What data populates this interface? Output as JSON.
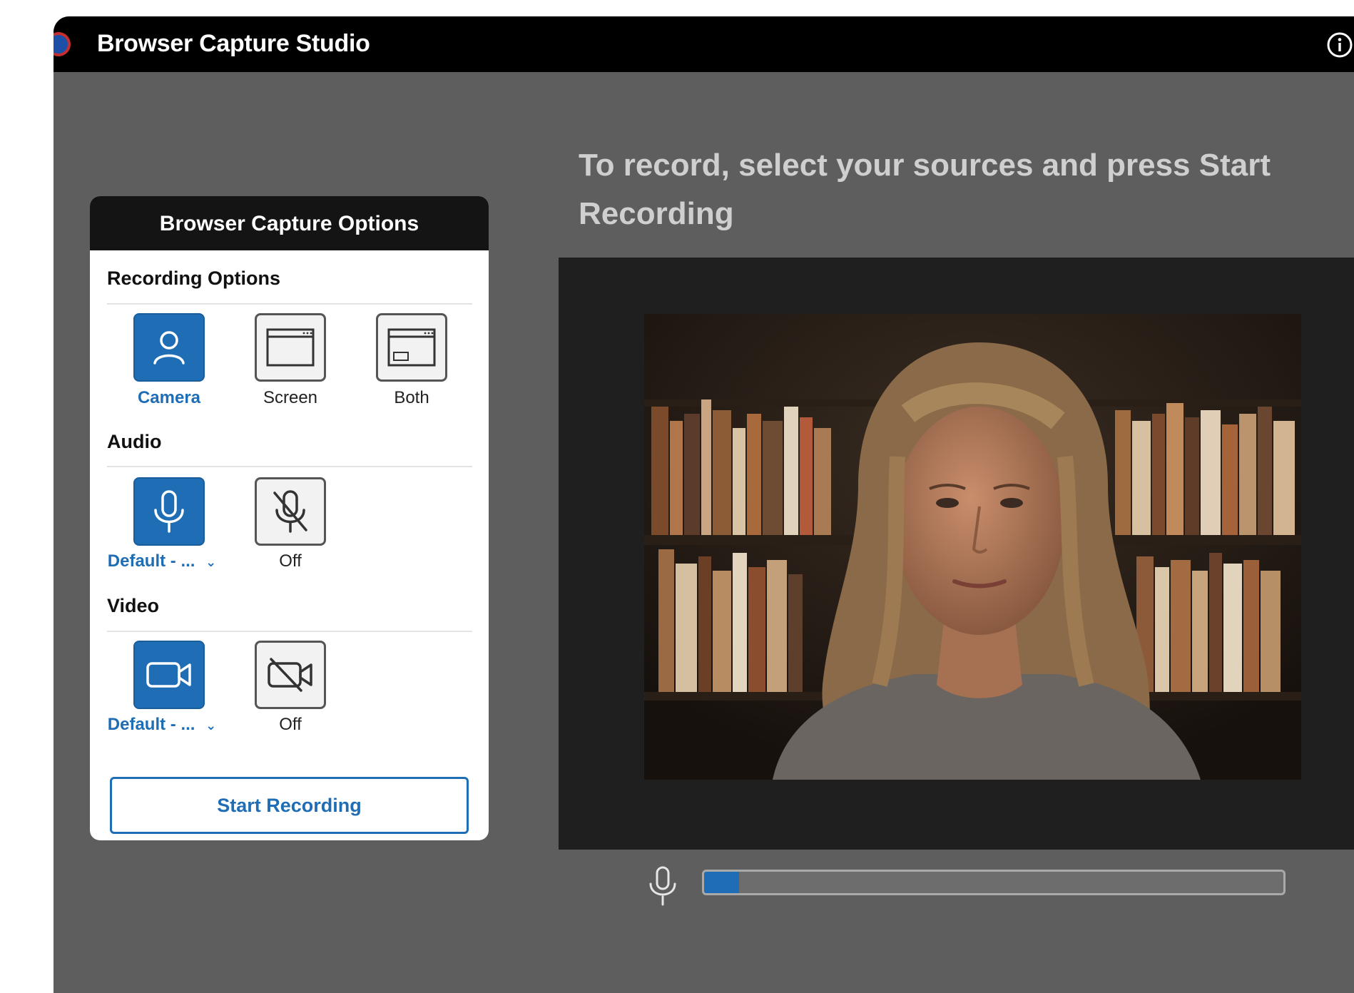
{
  "app": {
    "title": "Browser Capture Studio"
  },
  "panel": {
    "header": "Browser Capture Options",
    "recording_options": {
      "title": "Recording Options",
      "items": [
        {
          "label": "Camera",
          "icon": "person-icon",
          "selected": true
        },
        {
          "label": "Screen",
          "icon": "screen-window-icon",
          "selected": false
        },
        {
          "label": "Both",
          "icon": "screen-with-camera-icon",
          "selected": false
        }
      ]
    },
    "audio": {
      "title": "Audio",
      "device_label": "Default - ...",
      "off_label": "Off",
      "selected": "device"
    },
    "video": {
      "title": "Video",
      "device_label": "Default - ...",
      "off_label": "Off",
      "selected": "device"
    },
    "start_button": "Start Recording"
  },
  "main": {
    "instruction": "To record, select your sources and press Start Recording",
    "audio_level": 0.06
  },
  "colors": {
    "accent": "#1f6db5",
    "background": "#5e5e5e",
    "titlebar": "#000000"
  }
}
